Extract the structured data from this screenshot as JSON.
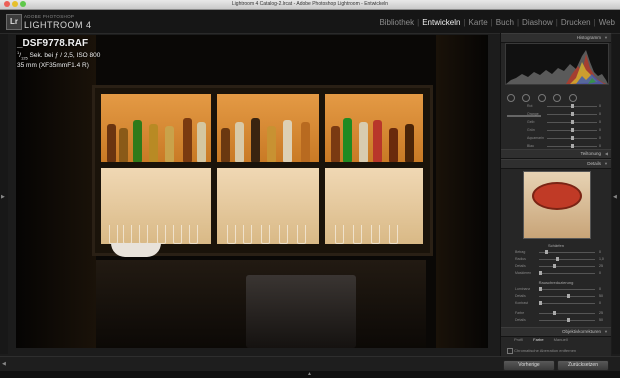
{
  "window": {
    "title": "Lightroom 4 Catalog-2.lrcat - Adobe Photoshop Lightroom - Entwickeln",
    "traffic_colors": [
      "#ec5f57",
      "#e6c02c",
      "#5fc84b"
    ]
  },
  "identity": {
    "logo_text": "Lr",
    "brand_small": "ADOBE PHOTOSHOP",
    "brand": "LIGHTROOM 4"
  },
  "modules": [
    {
      "label": "Bibliothek",
      "active": false
    },
    {
      "label": "Entwickeln",
      "active": true
    },
    {
      "label": "Karte",
      "active": false
    },
    {
      "label": "Buch",
      "active": false
    },
    {
      "label": "Diashow",
      "active": false
    },
    {
      "label": "Drucken",
      "active": false
    },
    {
      "label": "Web",
      "active": false
    }
  ],
  "photo_info": {
    "filename": "_DSF9778.RAF",
    "shutter_numerator": "1",
    "shutter_denominator": "125",
    "exposure_rest": "Sek. bei ƒ / 2,5, ISO 800",
    "lens": "35 mm (XF35mmF1.4 R)"
  },
  "panel": {
    "histogram_title": "Histogramm",
    "tone_curve_title": "Tonkurve",
    "split_toning_title": "Teiltonung",
    "details_title": "Details",
    "sharpening_title": "Schärfen",
    "noise_title": "Rauschreduzierung",
    "lens_title": "Objektivkorrekturen",
    "hsl_rows": [
      {
        "label": "Rot",
        "value": "0",
        "knob": 0.5
      },
      {
        "label": "Orange",
        "value": "0",
        "knob": 0.5
      },
      {
        "label": "Gelb",
        "value": "0",
        "knob": 0.5
      },
      {
        "label": "Grün",
        "value": "0",
        "knob": 0.5
      },
      {
        "label": "Aquamarin",
        "value": "0",
        "knob": 0.5
      },
      {
        "label": "Blau",
        "value": "0",
        "knob": 0.5
      },
      {
        "label": "Lila",
        "value": "0",
        "knob": 0.5
      },
      {
        "label": "Magenta",
        "value": "0",
        "knob": 0.5
      }
    ],
    "sharpen_rows": [
      {
        "label": "Betrag",
        "value": "0",
        "knob": 0.1
      },
      {
        "label": "Radius",
        "value": "1,0",
        "knob": 0.3
      },
      {
        "label": "Details",
        "value": "25",
        "knob": 0.25
      },
      {
        "label": "Maskieren",
        "value": "0",
        "knob": 0.0
      }
    ],
    "noise_rows": [
      {
        "label": "Luminanz",
        "value": "0",
        "knob": 0.0
      },
      {
        "label": "Details",
        "value": "50",
        "knob": 0.5
      },
      {
        "label": "Kontrast",
        "value": "0",
        "knob": 0.0
      },
      {
        "label": "Farbe",
        "value": "25",
        "knob": 0.25
      },
      {
        "label": "Details",
        "value": "50",
        "knob": 0.5
      }
    ],
    "lens_tabs": [
      {
        "label": "Profil",
        "active": false
      },
      {
        "label": "Farbe",
        "active": true
      },
      {
        "label": "Manuell",
        "active": false
      }
    ],
    "chromatic_label": "Chromatische Aberration entfernen"
  },
  "bottom": {
    "previous_label": "Vorherige",
    "reset_label": "Zurücksetzen"
  },
  "colors": {
    "accent": "#e8e8e8",
    "panel_bg": "#262626",
    "amber": "#d88a35"
  }
}
